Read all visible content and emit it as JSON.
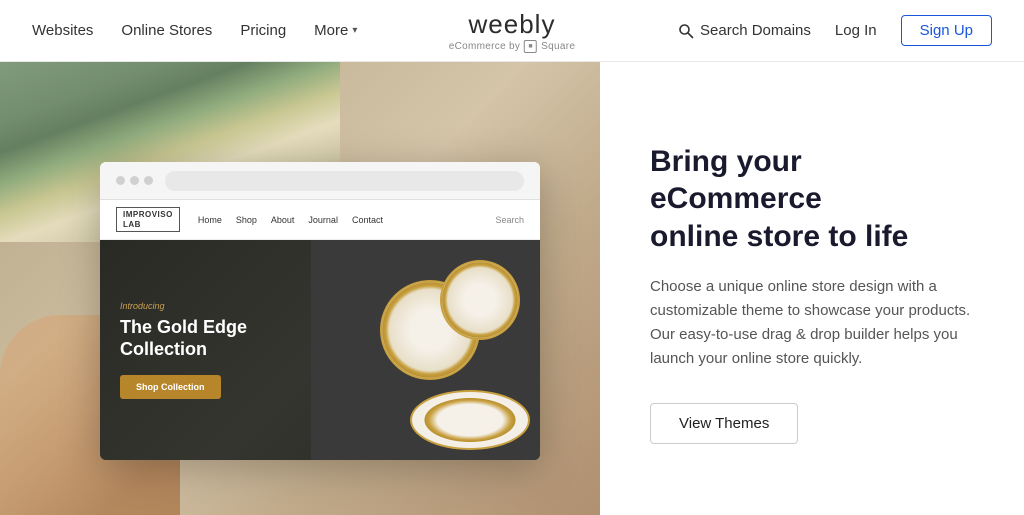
{
  "header": {
    "nav": {
      "websites": "Websites",
      "online_stores": "Online Stores",
      "pricing": "Pricing",
      "more": "More"
    },
    "logo": {
      "text": "weebly",
      "sub": "eCommerce by",
      "square": "■",
      "square_label": "Square"
    },
    "search_domains": "Search Domains",
    "login": "Log In",
    "signup": "Sign Up"
  },
  "browser_mockup": {
    "site_logo_line1": "IMPROVISO",
    "site_logo_line2": "LAB",
    "nav_home": "Home",
    "nav_shop": "Shop",
    "nav_about": "About",
    "nav_journal": "Journal",
    "nav_contact": "Contact",
    "nav_search": "Search",
    "hero_introducing": "Introducing",
    "hero_title_line1": "The Gold Edge",
    "hero_title_line2": "Collection",
    "hero_btn": "Shop Collection"
  },
  "right_content": {
    "heading_line1": "Bring your eCommerce",
    "heading_line2": "online store to life",
    "description": "Choose a unique online store design with a customizable theme to showcase your products. Our easy-to-use drag & drop builder helps you launch your online store quickly.",
    "cta_button": "View Themes"
  },
  "icons": {
    "search": "search-icon",
    "more_arrow": "chevron-down-icon"
  }
}
